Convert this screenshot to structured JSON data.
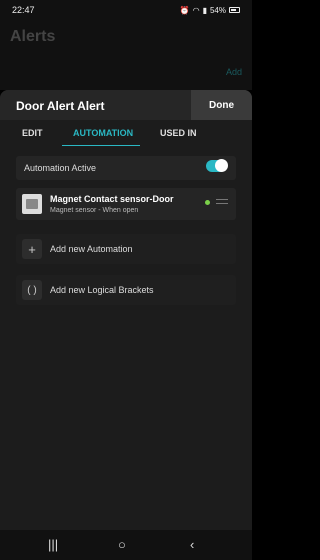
{
  "status": {
    "time": "22:47",
    "battery": "54%"
  },
  "background": {
    "title": "Alerts",
    "add_label": "Add"
  },
  "sheet": {
    "title": "Door Alert Alert",
    "done_label": "Done",
    "tabs": [
      {
        "label": "EDIT"
      },
      {
        "label": "AUTOMATION"
      },
      {
        "label": "USED IN"
      }
    ],
    "automation_active_label": "Automation Active",
    "automation_active": true,
    "sensor": {
      "name": "Magnet Contact sensor-Door",
      "subtitle": "Magnet sensor - When open"
    },
    "add_automation_label": "Add new Automation",
    "add_brackets_label": "Add new Logical Brackets"
  }
}
